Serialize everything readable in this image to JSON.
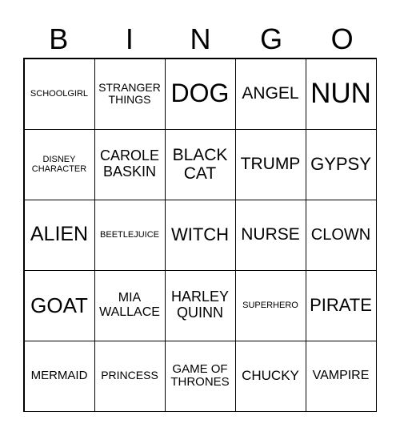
{
  "header": [
    "B",
    "I",
    "N",
    "G",
    "O"
  ],
  "cells": [
    "SCHOOLGIRL",
    "STRANGER THINGS",
    "DOG",
    "ANGEL",
    "NUN",
    "DISNEY CHARACTER",
    "CAROLE BASKIN",
    "BLACK CAT",
    "TRUMP",
    "GYPSY",
    "ALIEN",
    "BEETLEJUICE",
    "WITCH",
    "NURSE",
    "CLOWN",
    "GOAT",
    "MIA WALLACE",
    "HARLEY QUINN",
    "SUPERHERO",
    "PIRATE",
    "MERMAID",
    "PRINCESS",
    "GAME OF THRONES",
    "CHUCKY",
    "VAMPIRE"
  ]
}
